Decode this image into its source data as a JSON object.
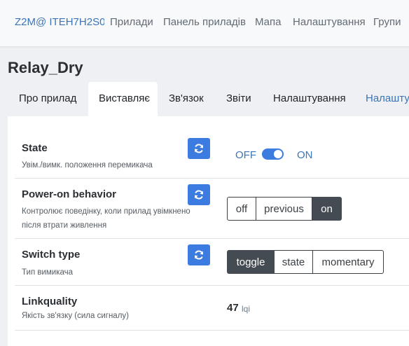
{
  "navbar": {
    "brand": "Z2M@ ITEH7H2S0",
    "items": [
      "Прилади",
      "Панель приладів",
      "Мапа",
      "Налаштування",
      "Групи"
    ]
  },
  "page": {
    "title": "Relay_Dry"
  },
  "tabs": [
    {
      "label": "Про прилад",
      "active": false
    },
    {
      "label": "Виставляє",
      "active": true
    },
    {
      "label": "Зв'язок",
      "active": false
    },
    {
      "label": "Звіти",
      "active": false
    },
    {
      "label": "Налаштування",
      "active": false
    },
    {
      "label": "Налашту",
      "active": false
    }
  ],
  "features": {
    "state": {
      "label": "State",
      "description": "Увім./вимк. положення перемикача",
      "off_label": "OFF",
      "on_label": "ON",
      "value": "ON"
    },
    "power_on_behavior": {
      "label": "Power-on behavior",
      "description_line1": "Контролює поведінку, коли прилад увімкнено",
      "description_line2": "після втрати живлення",
      "options": [
        "off",
        "previous",
        "on"
      ],
      "selected": "on"
    },
    "switch_type": {
      "label": "Switch type",
      "description": "Тип вимикача",
      "options": [
        "toggle",
        "state",
        "momentary"
      ],
      "selected": "toggle"
    },
    "linkquality": {
      "label": "Linkquality",
      "description": "Якість зв'язку (сила сигналу)",
      "value": "47",
      "unit": "lqi"
    }
  },
  "colors": {
    "accent": "#3c7be0",
    "link": "#3c74b5",
    "active_segment": "#454b52"
  },
  "icons": {
    "refresh": "refresh-icon"
  }
}
